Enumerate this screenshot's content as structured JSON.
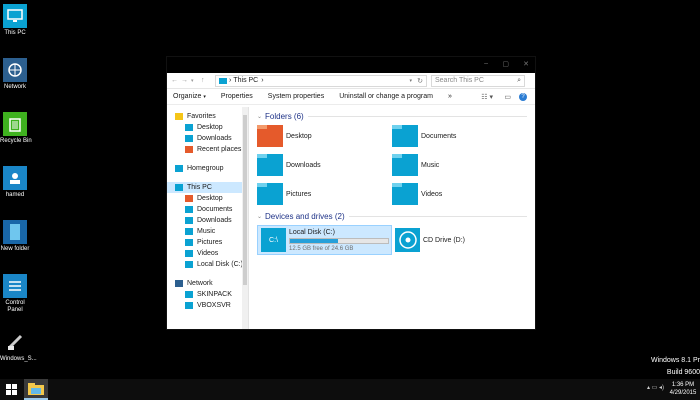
{
  "desktop_icons": [
    {
      "label": "This PC",
      "icon": "monitor-icon"
    },
    {
      "label": "Network",
      "icon": "network-icon"
    },
    {
      "label": "Recycle Bin",
      "icon": "recycle-bin-icon"
    },
    {
      "label": "hamed",
      "icon": "user-folder-icon"
    },
    {
      "label": "New folder",
      "icon": "folder-icon"
    },
    {
      "label": "Control Panel",
      "icon": "control-panel-icon"
    },
    {
      "label": "Windows_S...",
      "icon": "document-icon"
    }
  ],
  "watermark": {
    "line1": "Windows 8.1 Pr",
    "line2": "Build 9600"
  },
  "taskbar": {
    "time": "1:36 PM",
    "date": "4/29/2015"
  },
  "window": {
    "controls": [
      "–",
      "▢",
      "✕"
    ],
    "address": {
      "path": "This PC"
    },
    "search": {
      "placeholder": "Search This PC"
    },
    "commands": [
      "Organize",
      "Properties",
      "System properties",
      "Uninstall or change a program",
      "»"
    ],
    "nav": {
      "favorites": {
        "label": "Favorites",
        "items": [
          "Desktop",
          "Downloads",
          "Recent places"
        ]
      },
      "homegroup": "Homegroup",
      "thispc": {
        "label": "This PC",
        "items": [
          "Desktop",
          "Documents",
          "Downloads",
          "Music",
          "Pictures",
          "Videos",
          "Local Disk (C:)"
        ]
      },
      "network": {
        "label": "Network",
        "items": [
          "SKINPACK",
          "VBOXSVR"
        ]
      }
    },
    "folders_header": "Folders (6)",
    "folders": [
      "Desktop",
      "Documents",
      "Downloads",
      "Music",
      "Pictures",
      "Videos"
    ],
    "drives_header": "Devices and drives (2)",
    "drives": [
      {
        "name": "Local Disk (C:)",
        "free": "12.5 GB free of 24.6 GB",
        "used_fraction": 0.49,
        "glyph": "C:\\"
      },
      {
        "name": "CD Drive (D:)"
      }
    ]
  },
  "colors": {
    "accent": "#0aa2d2",
    "selection": "#cce8ff",
    "header_text": "#1e3287"
  }
}
